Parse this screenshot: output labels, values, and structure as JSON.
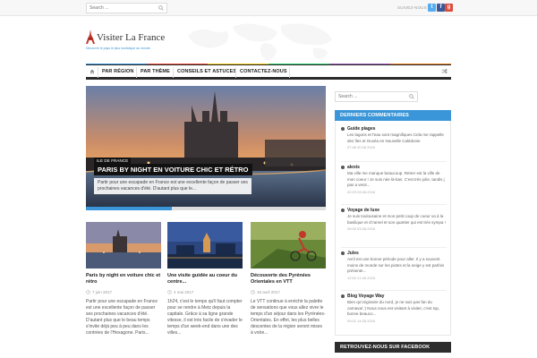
{
  "topbar": {
    "search_placeholder": "Search ...",
    "follow_label": "SUIVEZ-NOUS",
    "social": [
      {
        "name": "twitter",
        "glyph": "t",
        "color": "#55acee"
      },
      {
        "name": "facebook",
        "glyph": "f",
        "color": "#3b5998"
      },
      {
        "name": "google-plus",
        "glyph": "g",
        "color": "#dd4b39"
      }
    ]
  },
  "header": {
    "site_title": "Visiter La France",
    "tagline": "Découvrir le pays le plus touristique au monde"
  },
  "nav": {
    "items": [
      "PAR RÉGION",
      "PAR THÈME",
      "CONSEILS ET ASTUCES",
      "CONTACTEZ-NOUS"
    ],
    "stripe_colors": [
      "#3a96d8",
      "#e74c3c",
      "#f1c40f",
      "#2ecc71",
      "#9b59b6",
      "#e67e22"
    ]
  },
  "featured": {
    "category": "ILE DE FRANCE",
    "title": "PARIS BY NIGHT EN VOITURE CHIC ET RÉTRO",
    "excerpt": "Partir pour une escapade en France est une excellente façon de passer ses prochaines vacances d'été. D'autant plus que le...",
    "accent": "#3a96d8"
  },
  "posts": [
    {
      "title": "Paris by night en voiture chic et rétro",
      "date": "7 juin 2017",
      "excerpt": "Partir pour une escapade en France est une excellente façon de passer ses prochaines vacances d'été. D'autant plus que le beau temps s'invite déjà peu à peu dans les contrées de l'Hexagone. Paris..."
    },
    {
      "title": "Une visite guidée au coeur du centre...",
      "date": "4 mai 2017",
      "excerpt": "1h24, c'est le temps qu'il faut compter pour se rendre à Metz depuis la capitale. Grâce à sa ligne grande vitesse, il est très facile de s'évader le temps d'un week-end dans une des villes..."
    },
    {
      "title": "Découverte des Pyrénées Orientales en VTT",
      "date": "16 avril 2017",
      "excerpt": "Le VTT continue à enrichir la palette de sensations que vous allez vivre le temps d'un séjour dans les Pyrénées-Orientales. En effet, les plus belles descentes de la région seront mises à votre..."
    }
  ],
  "sidebar": {
    "search_placeholder": "Search ...",
    "comments_title": "DERNIERS COMMENTAIRES",
    "comments": [
      {
        "author": "Guide plages",
        "text": "Les lagons et l'eau sont magnifiques Cela me rappelle des îles et Ouvéa en Nouvelle Calédonie",
        "date": "07:48 30.06.2016"
      },
      {
        "author": "alexis",
        "text": "Ma ville me manque beaucoup. Retrer est la ville de mon coeur ! Je suis née là-bas. C'est très jolie, tandis j pas a venir...",
        "date": "02:29 03.06.2016"
      },
      {
        "author": "Voyage de luxe",
        "text": "Je suis toulousaine et mon petit coup de coeur va à la basilique et ch'arnel et son quartier qui est très sympa !",
        "date": "09:05 03.06.2016"
      },
      {
        "author": "Jules",
        "text": "Avril est une bonne période pour aller. Il y a souvent moins de monde sur les pistes et la neige y est parfois présente...",
        "date": "12:52 21.06.2016"
      },
      {
        "author": "Blog Voyage Way",
        "text": "Bien qu'originaire du nord, je ne suis pas fan du carnaval :) Nous nous est visitant à visiter, c'est top, bonne beauco...",
        "date": "09:02 14.05.2016"
      }
    ],
    "facebook_title": "RETROUVEZ-NOUS SUR FACEBOOK"
  }
}
